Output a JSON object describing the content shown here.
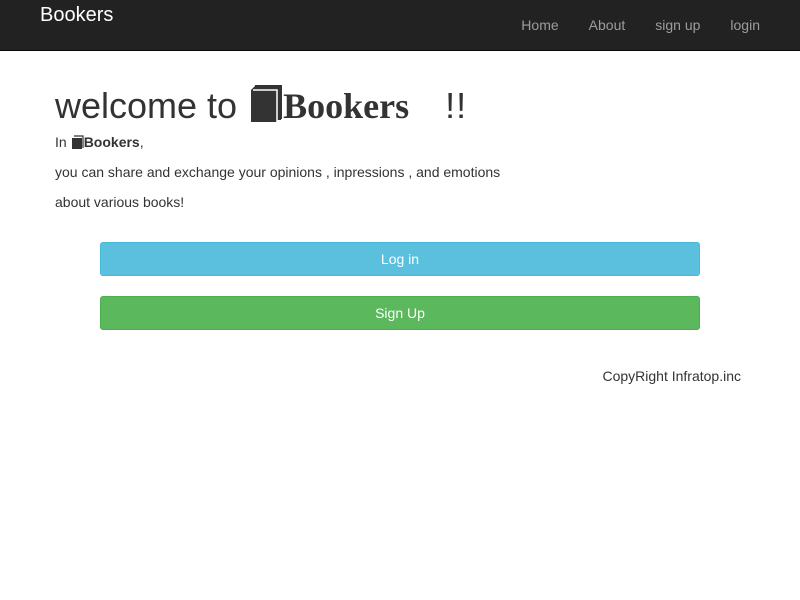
{
  "navbar": {
    "brand": "Bookers",
    "links": [
      "Home",
      "About",
      "sign up",
      "login"
    ]
  },
  "welcome": {
    "prefix": "welcome to",
    "brand": "Bookers",
    "suffix": "!!",
    "book_icon": "book-icon"
  },
  "intro": {
    "in_prefix": "In",
    "brand": "Bookers",
    "comma": ",",
    "line2": "you can share and exchange your opinions , inpressions , and emotions",
    "line3": "about various books!"
  },
  "buttons": {
    "login_label": "Log in",
    "signup_label": "Sign Up"
  },
  "footer": {
    "copyright": "CopyRight Infratop.inc"
  },
  "colors": {
    "navbar_bg": "#222222",
    "nav_link": "#9d9d9d",
    "login_button": "#5bc0de",
    "signup_button": "#5cb85c"
  }
}
